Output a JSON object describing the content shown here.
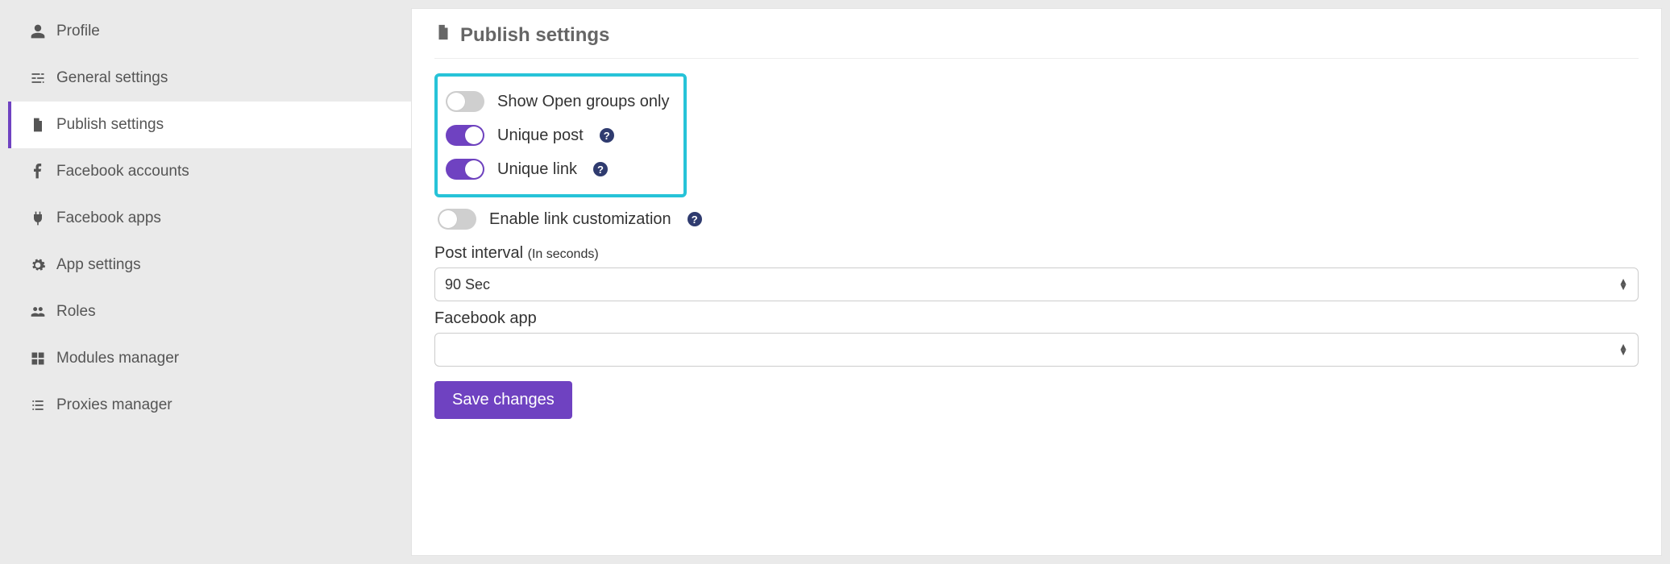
{
  "sidebar": {
    "items": [
      {
        "label": "Profile",
        "icon": "user-icon"
      },
      {
        "label": "General settings",
        "icon": "sliders-icon"
      },
      {
        "label": "Publish settings",
        "icon": "file-icon"
      },
      {
        "label": "Facebook accounts",
        "icon": "facebook-icon"
      },
      {
        "label": "Facebook apps",
        "icon": "plug-icon"
      },
      {
        "label": "App settings",
        "icon": "cogs-icon"
      },
      {
        "label": "Roles",
        "icon": "users-icon"
      },
      {
        "label": "Modules manager",
        "icon": "grid-icon"
      },
      {
        "label": "Proxies manager",
        "icon": "list-icon"
      }
    ],
    "active_index": 2
  },
  "page": {
    "title": "Publish settings"
  },
  "toggles": {
    "show_open_groups": {
      "label": "Show Open groups only",
      "on": false,
      "help": false
    },
    "unique_post": {
      "label": "Unique post",
      "on": true,
      "help": true
    },
    "unique_link": {
      "label": "Unique link",
      "on": true,
      "help": true
    },
    "enable_link_cust": {
      "label": "Enable link customization",
      "on": false,
      "help": true
    }
  },
  "fields": {
    "post_interval": {
      "label": "Post interval",
      "sub": "(In seconds)",
      "value": "90 Sec"
    },
    "facebook_app": {
      "label": "Facebook app",
      "value": ""
    }
  },
  "buttons": {
    "save": "Save changes"
  },
  "help_glyph": "?"
}
